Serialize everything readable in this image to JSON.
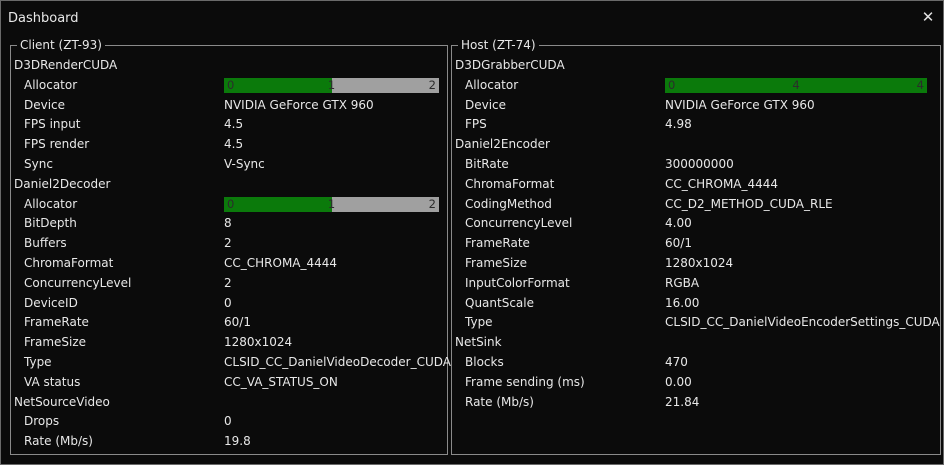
{
  "window": {
    "title": "Dashboard",
    "close_icon": "close-icon"
  },
  "client": {
    "legend": "Client (ZT-93)",
    "d3drender": {
      "title": "D3DRenderCUDA",
      "allocator_label": "Allocator",
      "allocator": {
        "min": "0",
        "mid": "1",
        "max": "2",
        "fill_fraction": 0.5
      },
      "device_label": "Device",
      "device": "NVIDIA GeForce GTX 960",
      "fps_input_label": "FPS input",
      "fps_input": "4.5",
      "fps_render_label": "FPS render",
      "fps_render": "4.5",
      "sync_label": "Sync",
      "sync": "V-Sync"
    },
    "decoder": {
      "title": "Daniel2Decoder",
      "allocator_label": "Allocator",
      "allocator": {
        "min": "0",
        "mid": "1",
        "max": "2",
        "fill_fraction": 0.5
      },
      "bitdepth_label": "BitDepth",
      "bitdepth": "8",
      "buffers_label": "Buffers",
      "buffers": "2",
      "chroma_label": "ChromaFormat",
      "chroma": "CC_CHROMA_4444",
      "concurrency_label": "ConcurrencyLevel",
      "concurrency": "2",
      "deviceid_label": "DeviceID",
      "deviceid": "0",
      "framerate_label": "FrameRate",
      "framerate": "60/1",
      "framesize_label": "FrameSize",
      "framesize": "1280x1024",
      "type_label": "Type",
      "type": "CLSID_CC_DanielVideoDecoder_CUDA",
      "vastatus_label": "VA status",
      "vastatus": "CC_VA_STATUS_ON"
    },
    "netsource": {
      "title": "NetSourceVideo",
      "drops_label": "Drops",
      "drops": "0",
      "rate_label": "Rate (Mb/s)",
      "rate": "19.8"
    }
  },
  "host": {
    "legend": "Host (ZT-74)",
    "grabber": {
      "title": "D3DGrabberCUDA",
      "allocator_label": "Allocator",
      "allocator": {
        "min": "0",
        "mid": "4",
        "max": "4",
        "fill_fraction": 1.0
      },
      "device_label": "Device",
      "device": "NVIDIA GeForce GTX 960",
      "fps_label": "FPS",
      "fps": "4.98"
    },
    "encoder": {
      "title": "Daniel2Encoder",
      "bitrate_label": "BitRate",
      "bitrate": "300000000",
      "chroma_label": "ChromaFormat",
      "chroma": "CC_CHROMA_4444",
      "coding_label": "CodingMethod",
      "coding": "CC_D2_METHOD_CUDA_RLE",
      "concurrency_label": "ConcurrencyLevel",
      "concurrency": "4.00",
      "framerate_label": "FrameRate",
      "framerate": "60/1",
      "framesize_label": "FrameSize",
      "framesize": "1280x1024",
      "inputcolor_label": "InputColorFormat",
      "inputcolor": "RGBA",
      "quant_label": "QuantScale",
      "quant": "16.00",
      "type_label": "Type",
      "type": "CLSID_CC_DanielVideoEncoderSettings_CUDA"
    },
    "netsink": {
      "title": "NetSink",
      "blocks_label": "Blocks",
      "blocks": "470",
      "sending_label": "Frame sending (ms)",
      "sending": "0.00",
      "rate_label": "Rate (Mb/s)",
      "rate": "21.84"
    }
  },
  "colors": {
    "bar_fill": "#0b7a0b",
    "bar_track": "#a0a0a0",
    "background": "#0b0b0b",
    "border": "#8a8a8a"
  }
}
